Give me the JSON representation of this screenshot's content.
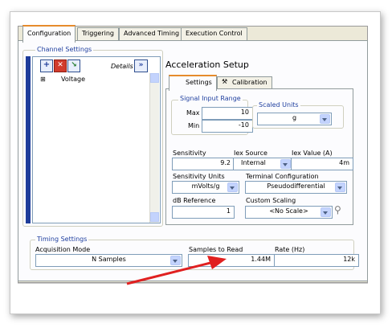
{
  "tabs": [
    "Configuration",
    "Triggering",
    "Advanced Timing",
    "Execution Control"
  ],
  "channel_settings": {
    "title": "Channel Settings",
    "details_label": "Details",
    "tree_item": "Voltage"
  },
  "task": {
    "title": "Acceleration Setup",
    "subtabs": [
      "Settings",
      "Calibration"
    ]
  },
  "signal_input_range": {
    "title": "Signal Input Range",
    "max_label": "Max",
    "max_value": "10",
    "min_label": "Min",
    "min_value": "-10"
  },
  "scaled_units": {
    "title": "Scaled Units",
    "value": "g"
  },
  "sensitivity": {
    "label": "Sensitivity",
    "value": "9.2"
  },
  "iex_source": {
    "label": "Iex Source",
    "value": "Internal"
  },
  "iex_value": {
    "label": "Iex Value (A)",
    "value": "4m"
  },
  "sensitivity_units": {
    "label": "Sensitivity Units",
    "value": "mVolts/g"
  },
  "terminal_config": {
    "label": "Terminal Configuration",
    "value": "Pseudodifferential"
  },
  "db_reference": {
    "label": "dB Reference",
    "value": "1"
  },
  "custom_scaling": {
    "label": "Custom Scaling",
    "value": "<No Scale>"
  },
  "timing": {
    "title": "Timing Settings",
    "mode_label": "Acquisition Mode",
    "mode_value": "N Samples",
    "samples_label": "Samples to Read",
    "samples_value": "1.44M",
    "rate_label": "Rate (Hz)",
    "rate_value": "12k"
  },
  "colors": {
    "accent_tab": "#e68b2c",
    "group_label": "#1f3f9f",
    "arrow": "#e02020"
  }
}
